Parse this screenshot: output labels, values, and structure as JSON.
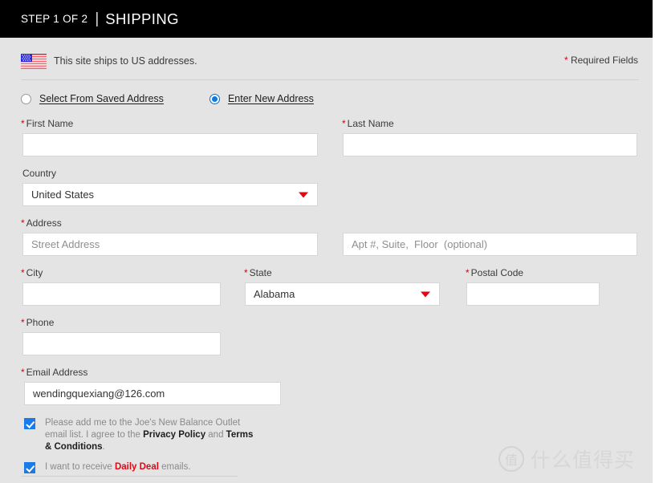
{
  "header": {
    "step_label": "STEP 1 OF 2",
    "divider": "|",
    "title": "SHIPPING"
  },
  "notice": {
    "flag_icon": "us-flag-icon",
    "ships_text": "This site ships to US addresses.",
    "required_star": "*",
    "required_text": "Required Fields"
  },
  "address_mode": {
    "options": [
      {
        "label": "Select From Saved Address",
        "selected": false
      },
      {
        "label": "Enter New Address",
        "selected": true
      }
    ]
  },
  "form": {
    "first_name": {
      "label": "First Name",
      "required": "*",
      "value": "",
      "placeholder": ""
    },
    "last_name": {
      "label": "Last Name",
      "required": "*",
      "value": "",
      "placeholder": ""
    },
    "country": {
      "label": "Country",
      "required": "",
      "value": "United States",
      "arrow_icon": "caret-down-icon"
    },
    "address": {
      "label": "Address",
      "required": "*",
      "value": "",
      "placeholder": "Street Address"
    },
    "address2": {
      "label": "",
      "required": "",
      "value": "",
      "placeholder": "Apt #, Suite,  Floor  (optional)"
    },
    "city": {
      "label": "City",
      "required": "*",
      "value": "",
      "placeholder": ""
    },
    "state": {
      "label": "State",
      "required": "*",
      "value": "Alabama",
      "arrow_icon": "caret-down-icon"
    },
    "postal_code": {
      "label": "Postal Code",
      "required": "*",
      "value": "",
      "placeholder": ""
    },
    "phone": {
      "label": "Phone",
      "required": "*",
      "value": "",
      "placeholder": ""
    },
    "email": {
      "label": "Email Address",
      "required": "*",
      "value": "wendingquexiang@126.com",
      "placeholder": ""
    }
  },
  "consents": {
    "newsletter": {
      "checked": true,
      "text_part1": "Please add me to the Joe's New Balance Outlet email list. I agree to the ",
      "privacy_policy": "Privacy Policy",
      "text_part2": " and ",
      "terms": "Terms & Conditions",
      "text_part3": "."
    },
    "daily_deal": {
      "checked": true,
      "text_part1": "I want to receive ",
      "highlight": "Daily Deal",
      "text_part2": " emails."
    }
  },
  "watermark": {
    "badge": "值",
    "text": "什么值得买"
  },
  "colors": {
    "header_bg": "#000000",
    "page_bg": "#e4e4e4",
    "required_red": "#d0021b",
    "accent_red": "#e30613",
    "radio_blue": "#1178e0",
    "checkbox_blue": "#1a7ae8"
  }
}
